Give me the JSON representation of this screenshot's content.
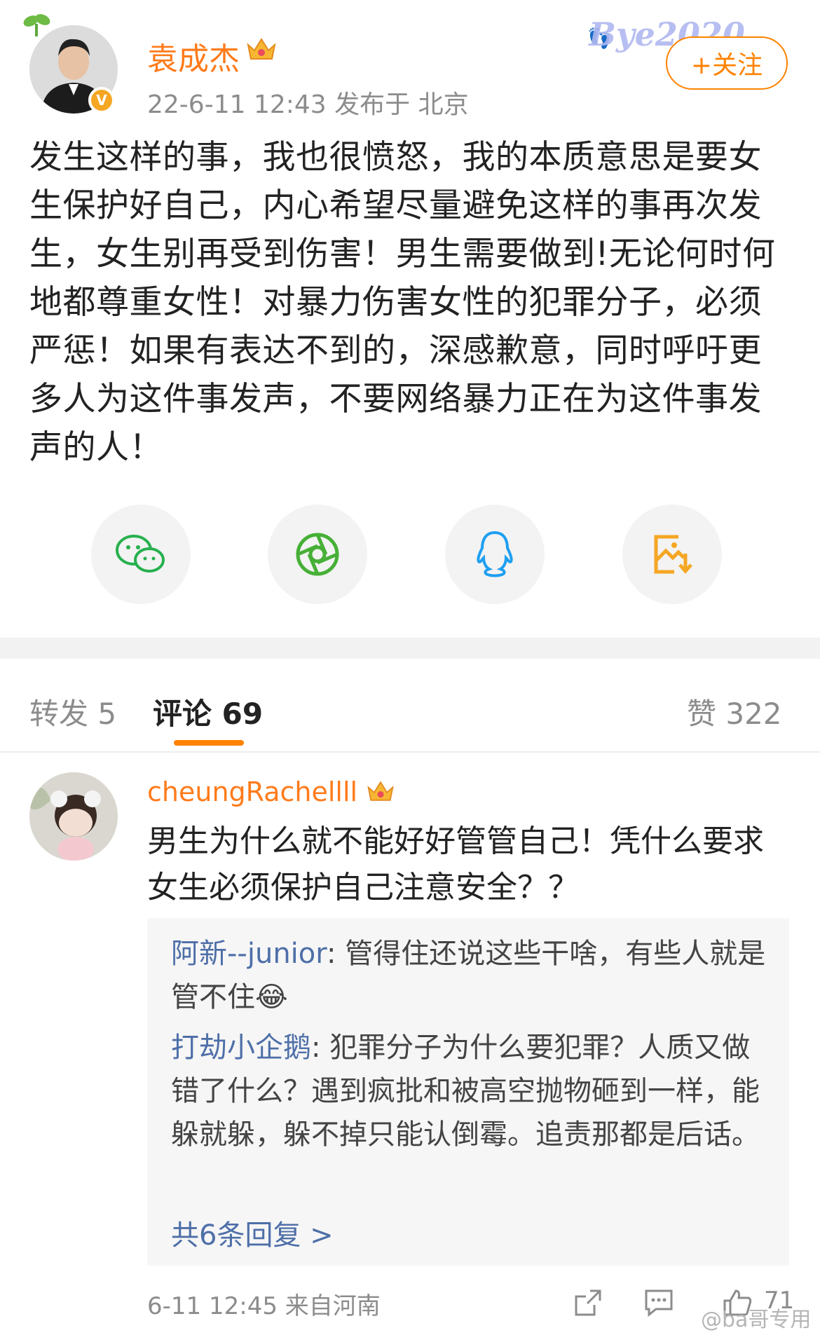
{
  "post": {
    "author": "袁成杰",
    "meta": "22-6-11 12:43  发布于 北京",
    "follow_label": "+关注",
    "sticker_text": "Bye2020",
    "text": "发生这样的事，我也很愤怒，我的本质意思是要女生保护好自己，内心希望尽量避免这样的事再次发生，女生别再受到伤害！男生需要做到!无论何时何地都尊重女性！对暴力伤害女性的犯罪分子，必须严惩！如果有表达不到的，深感歉意，同时呼吁更多人为这件事发声，不要网络暴力正在为这件事发声的人！"
  },
  "share_icons": [
    "wechat-icon",
    "moments-icon",
    "qq-icon",
    "save-image-icon"
  ],
  "tabs": {
    "repost": "转发 5",
    "comment": "评论 69",
    "like": "赞 322"
  },
  "comment": {
    "author": "cheungRachellll",
    "text": "男生为什么就不能好好管管自己！凭什么要求女生必须保护自己注意安全？？",
    "replies": [
      {
        "user": "阿新--junior",
        "text": ": 管得住还说这些干啥，有些人就是管不住😂"
      },
      {
        "user": "打劫小企鹅",
        "text": ": 犯罪分子为什么要犯罪？人质又做错了什么？遇到疯批和被高空抛物砸到一样，能躲就躲，躲不掉只能认倒霉。追责那都是后话。"
      }
    ],
    "more_replies": "共6条回复 >",
    "meta": "6-11 12:45  来自河南",
    "like_count": "71"
  },
  "watermark": "@ba哥专用",
  "colors": {
    "accent": "#ff8200",
    "name": "#ff7b1b",
    "link": "#4e6fa8"
  }
}
